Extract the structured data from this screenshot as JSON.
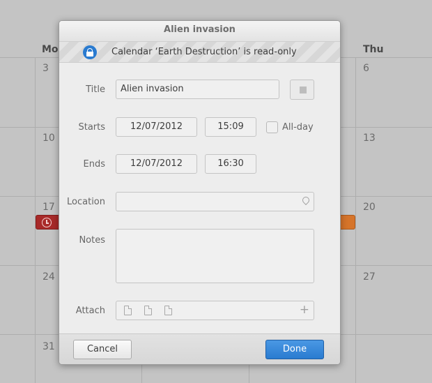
{
  "calendar": {
    "headers": {
      "mon": "Mo",
      "thu": "Thu"
    },
    "days": {
      "r1_mon": "3",
      "r1_thu": "6",
      "r2_mon": "10",
      "r2_thu": "13",
      "r3_mon": "17",
      "r3_thu": "20",
      "r4_mon": "24",
      "r4_thu": "27",
      "r5_mon": "31"
    }
  },
  "dialog": {
    "title": "Alien invasion",
    "infobar": "Calendar ‘Earth Destruction’ is read-only",
    "labels": {
      "title": "Title",
      "starts": "Starts",
      "ends": "Ends",
      "location": "Location",
      "notes": "Notes",
      "attach": "Attach",
      "allday": "All-day"
    },
    "values": {
      "title": "Alien invasion",
      "start_date": "12/07/2012",
      "start_time": "15:09",
      "end_date": "12/07/2012",
      "end_time": "16:30",
      "location": "",
      "notes": ""
    },
    "buttons": {
      "cancel": "Cancel",
      "done": "Done"
    }
  },
  "colors": {
    "accent": "#2a7bd0",
    "event_red": "#a82a29",
    "event_orange": "#d6742a"
  }
}
